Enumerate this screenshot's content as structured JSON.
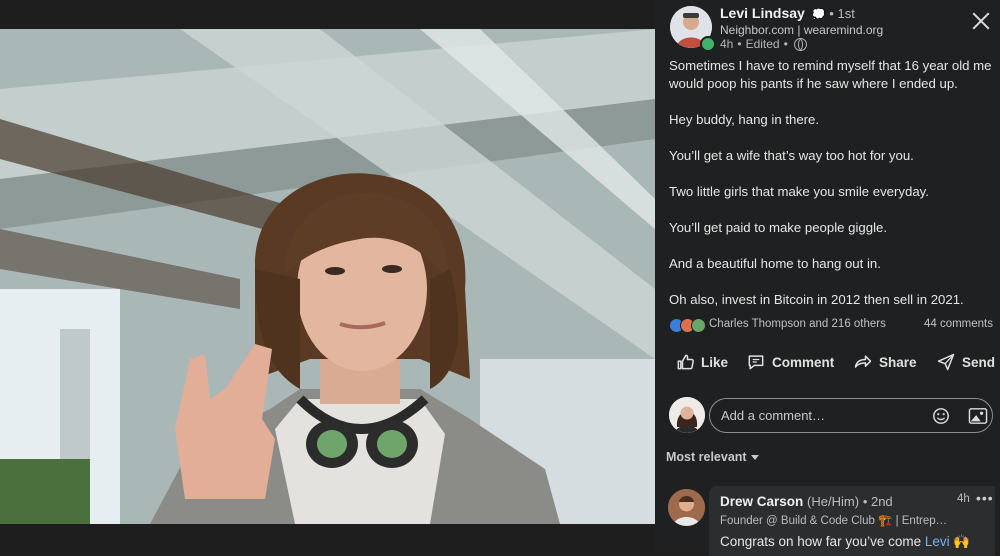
{
  "post": {
    "author": {
      "name": "Levi Lindsay",
      "degree": "1st",
      "headline": "Neighbor.com | wearemind.org",
      "time": "4h",
      "edited": "Edited"
    },
    "text": [
      "Sometimes I have to remind myself that 16 year old me would poop his pants if he saw where I ended up.",
      "Hey buddy, hang in there.",
      "You’ll get a wife that’s way too hot for you.",
      "Two little girls that make you smile everyday.",
      "You’ll get paid to make people giggle.",
      "And a beautiful home to hang out in.",
      "Oh also, invest in Bitcoin in 2012 then sell in 2021."
    ],
    "reactions": {
      "summary": "Charles Thompson and 216 others",
      "comments": "44 comments",
      "icons": [
        "like-icon",
        "love-icon",
        "support-icon"
      ]
    }
  },
  "actions": {
    "like": "Like",
    "comment": "Comment",
    "share": "Share",
    "send": "Send"
  },
  "comment_input": {
    "placeholder": "Add a comment…"
  },
  "sort": {
    "label": "Most relevant"
  },
  "comments": [
    {
      "name": "Drew Carson",
      "pronouns": "(He/Him)",
      "degree": "• 2nd",
      "time": "4h",
      "more": "•••",
      "headline": "Founder @ Build & Code Club 🏗️ | Entrep…",
      "text": "Congrats on how far you’ve come",
      "mention": "Levi",
      "emoji": "🙌"
    }
  ],
  "colors": {
    "background": "#1f2021",
    "accent": "#7ab0f2",
    "online": "#3fb36a"
  }
}
